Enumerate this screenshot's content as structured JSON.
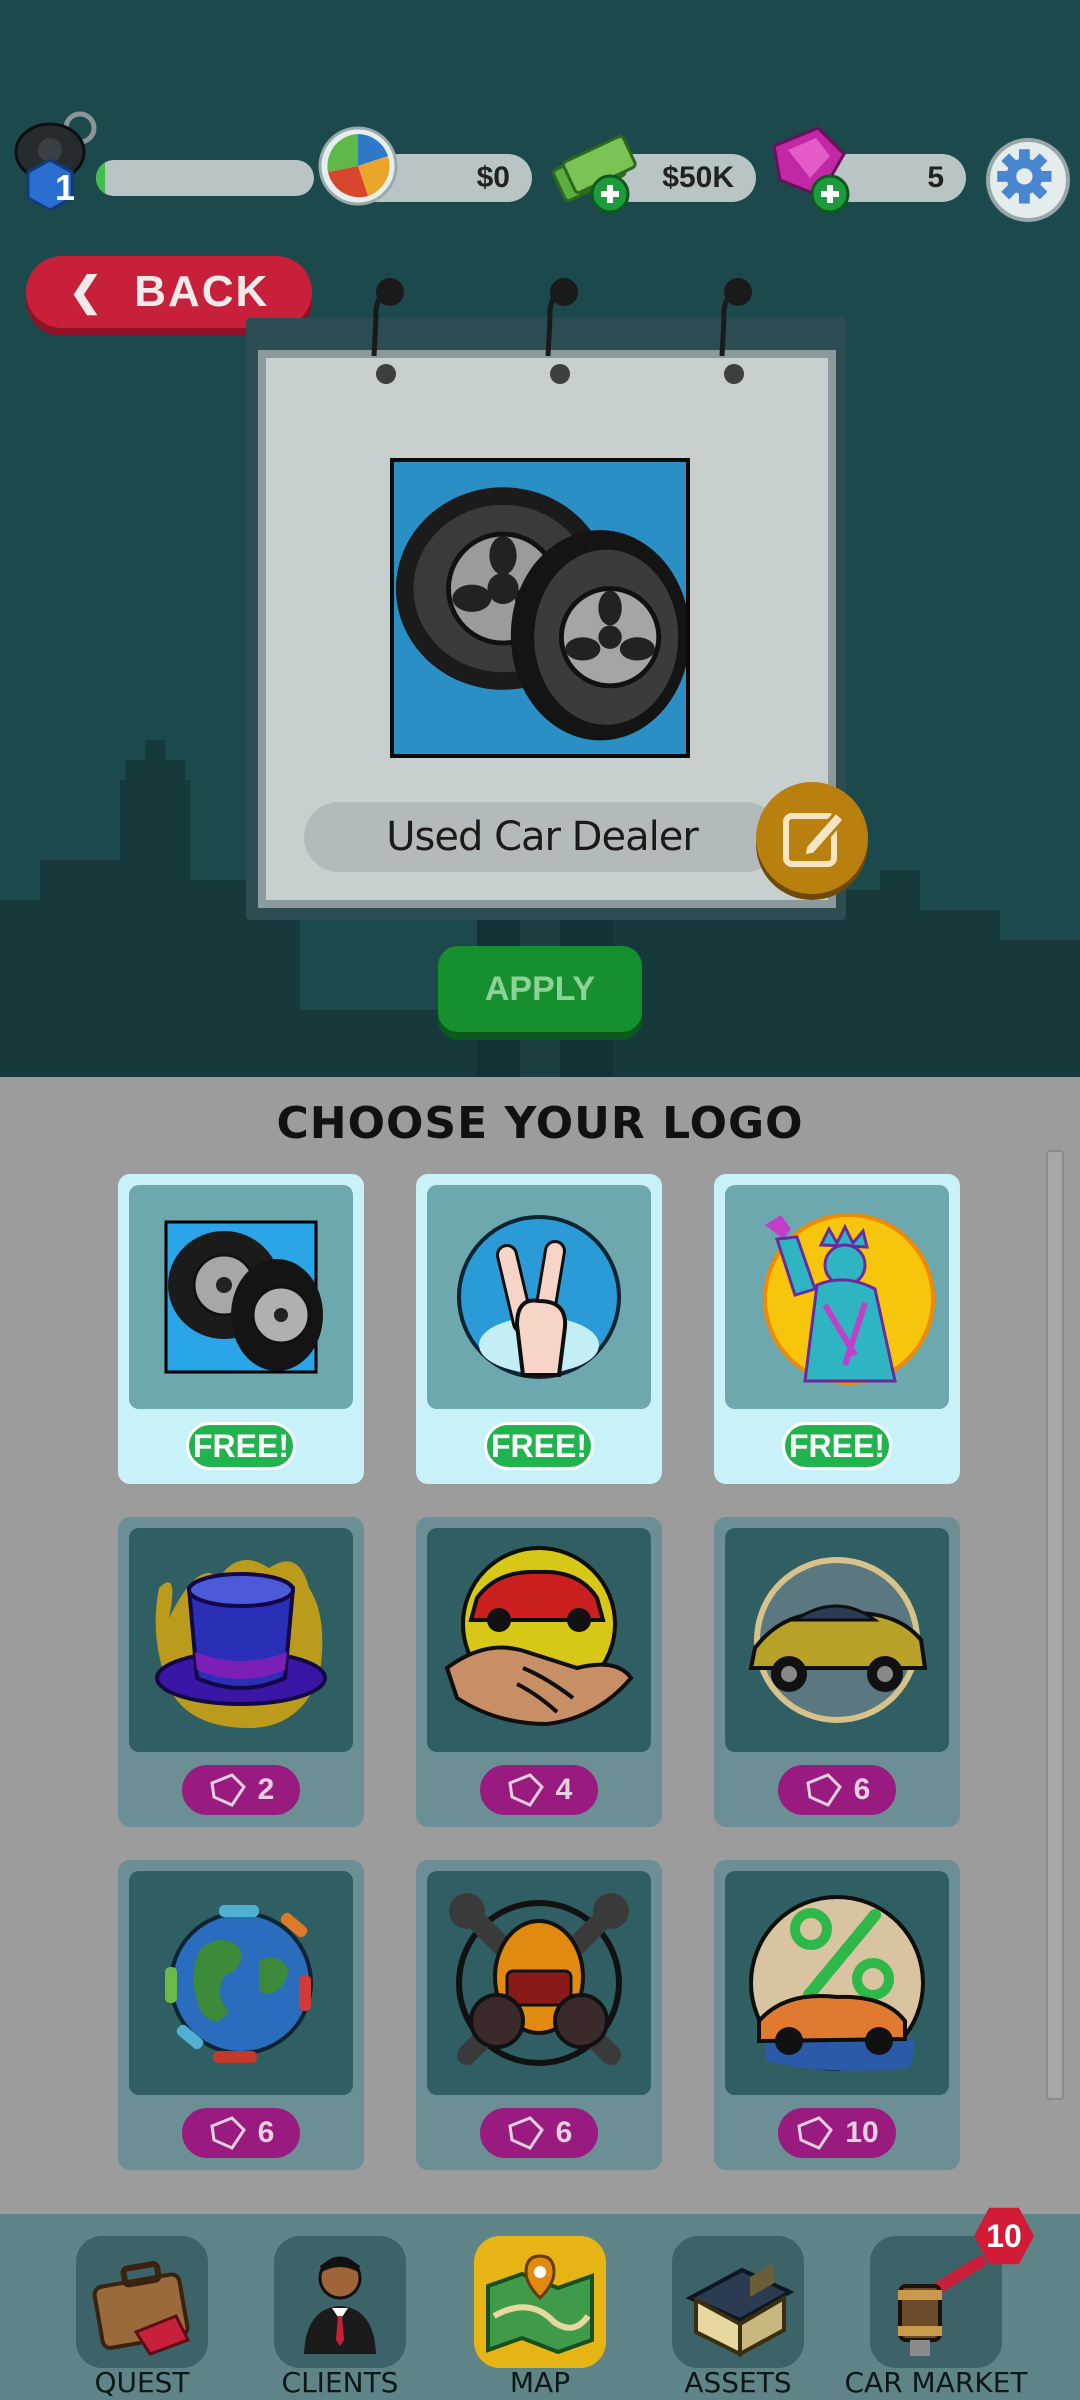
{
  "hud": {
    "level": "1",
    "level_progress": 0.04,
    "value_amount": "$0",
    "cash_amount": "$50K",
    "gems_amount": "5"
  },
  "back_button": {
    "label": "BACK"
  },
  "billboard": {
    "dealer_name": "Used Car Dealer",
    "apply_label": "APPLY"
  },
  "logo_panel": {
    "title": "CHOOSE YOUR LOGO",
    "logos": [
      {
        "icon": "tires-logo",
        "price": "FREE!",
        "free": true,
        "selected": true
      },
      {
        "icon": "peace-hand-logo",
        "price": "FREE!",
        "free": true
      },
      {
        "icon": "statue-of-liberty-logo",
        "price": "FREE!",
        "free": true
      },
      {
        "icon": "top-hat-logo",
        "price": "2",
        "free": false
      },
      {
        "icon": "handshake-car-logo",
        "price": "4",
        "free": false
      },
      {
        "icon": "classic-car-logo",
        "price": "6",
        "free": false
      },
      {
        "icon": "globe-cars-logo",
        "price": "6",
        "free": false
      },
      {
        "icon": "wrench-helmet-logo",
        "price": "6",
        "free": false
      },
      {
        "icon": "percent-car-logo",
        "price": "10",
        "free": false
      }
    ]
  },
  "nav": {
    "items": [
      {
        "label": "QUEST",
        "icon": "briefcase-icon"
      },
      {
        "label": "CLIENTS",
        "icon": "client-icon"
      },
      {
        "label": "MAP",
        "icon": "map-icon",
        "active": true
      },
      {
        "label": "ASSETS",
        "icon": "house-icon"
      },
      {
        "label": "CAR MARKET",
        "icon": "auction-hammer-icon"
      }
    ],
    "car_market_badge": "10"
  },
  "colors": {
    "scene_bg": "#1c4a4c",
    "panel_bg": "#9c9c9c",
    "back_red": "#c8203a",
    "apply_green": "#16902f",
    "free_green": "#21b34e",
    "gem_magenta": "#9a1b80",
    "nav_active": "#e6b415"
  }
}
